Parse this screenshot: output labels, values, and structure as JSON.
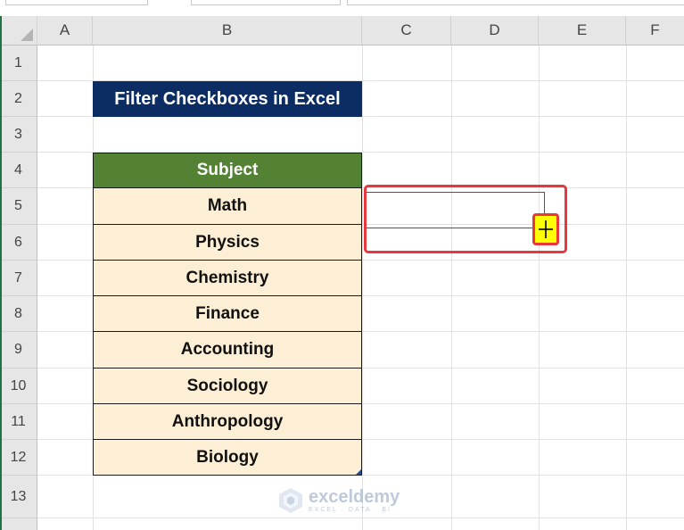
{
  "columns": [
    "A",
    "B",
    "C",
    "D",
    "E",
    "F"
  ],
  "rows": [
    "1",
    "2",
    "3",
    "4",
    "5",
    "6",
    "7",
    "8",
    "9",
    "10",
    "11",
    "12",
    "13"
  ],
  "title": "Filter Checkboxes in Excel",
  "table": {
    "header": "Subject",
    "items": [
      "Math",
      "Physics",
      "Chemistry",
      "Finance",
      "Accounting",
      "Sociology",
      "Anthropology",
      "Biology"
    ]
  },
  "watermark": {
    "name": "exceldemy",
    "tagline": "EXCEL · DATA · BI"
  },
  "icons": {
    "cursor": "crosshair-cursor-icon",
    "select_all": "select-all-triangle-icon",
    "logo": "exceldemy-logo-icon"
  },
  "colors": {
    "title_bg": "#0c2d63",
    "header_bg": "#548235",
    "cell_bg": "#fdefd5",
    "highlight": "#e8383d",
    "cursor_bg": "#ffff00"
  }
}
